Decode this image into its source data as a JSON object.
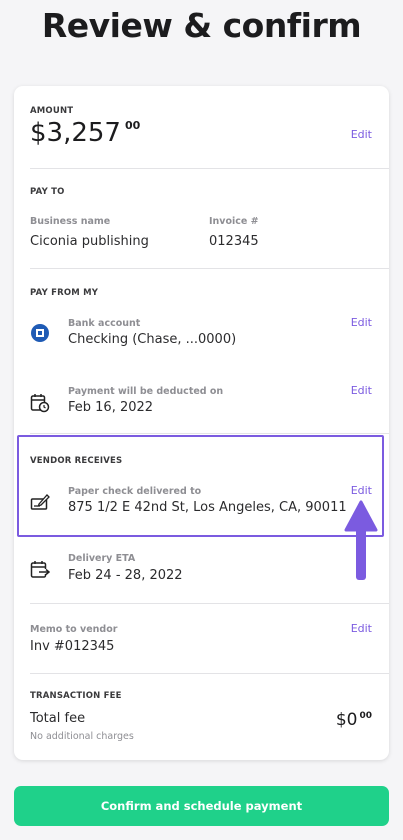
{
  "page": {
    "title": "Review & confirm"
  },
  "amount": {
    "label": "AMOUNT",
    "dollars": "$3,257",
    "cents": "00",
    "edit": "Edit"
  },
  "pay_to": {
    "label": "PAY TO",
    "business_label": "Business name",
    "business_value": "Ciconia publishing",
    "invoice_label": "Invoice #",
    "invoice_value": "012345"
  },
  "pay_from": {
    "label": "PAY FROM MY",
    "bank_label": "Bank account",
    "bank_value": "Checking (Chase, ...0000)",
    "bank_edit": "Edit",
    "deduct_label": "Payment will be deducted on",
    "deduct_value": "Feb 16, 2022",
    "deduct_edit": "Edit"
  },
  "vendor": {
    "label": "VENDOR RECEIVES",
    "delivery_label": "Paper check delivered to",
    "delivery_value": "875 1/2 E 42nd St, Los Angeles, CA, 90011",
    "delivery_edit": "Edit",
    "eta_label": "Delivery ETA",
    "eta_value": "Feb 24 - 28, 2022"
  },
  "memo": {
    "label": "Memo to vendor",
    "value": "Inv #012345",
    "edit": "Edit"
  },
  "fee": {
    "label": "TRANSACTION FEE",
    "total_label": "Total fee",
    "note": "No additional charges",
    "dollars": "$0",
    "cents": "00"
  },
  "confirm_button": "Confirm and schedule payment",
  "icons": {
    "bank": "bank-logo-icon",
    "calendar": "calendar-clock-icon",
    "check": "paper-check-icon",
    "delivery": "calendar-arrow-icon"
  },
  "colors": {
    "accent": "#7b5be0",
    "confirm": "#1fd18a",
    "bank_logo": "#1f5bb5"
  }
}
